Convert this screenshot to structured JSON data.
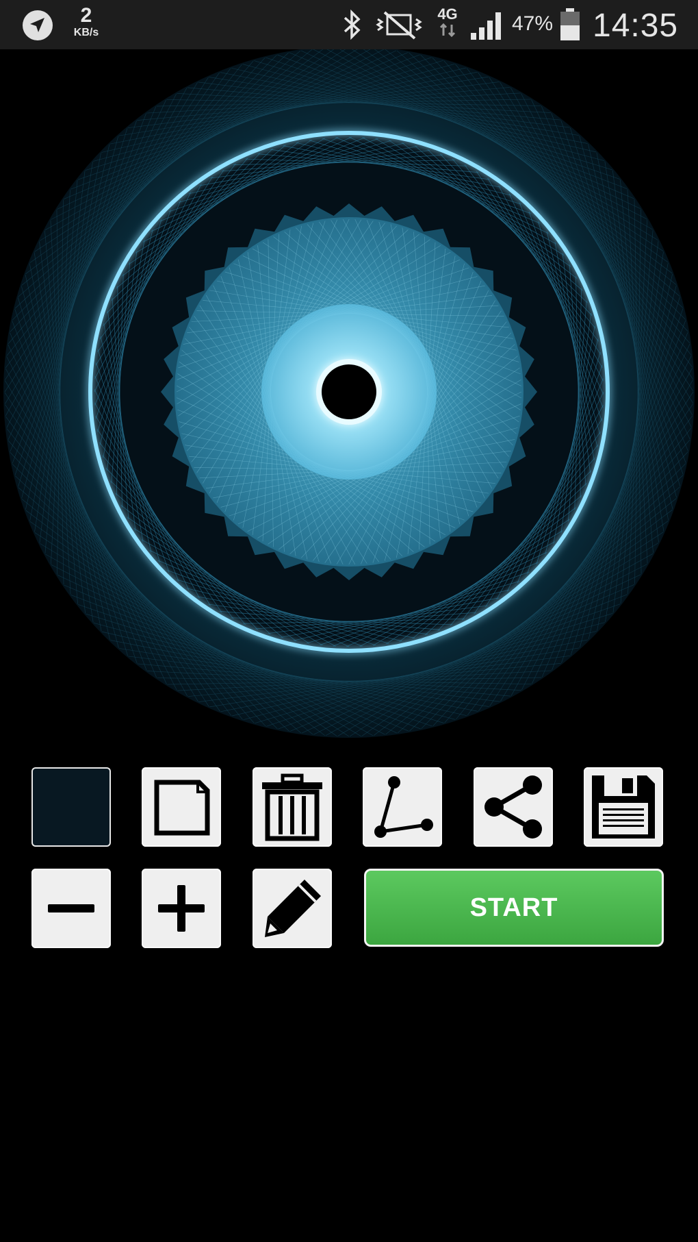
{
  "status_bar": {
    "speed_value": "2",
    "speed_unit": "KB/s",
    "network_type": "4G",
    "battery_percent": "47%",
    "time": "14:35",
    "icons": [
      "navigation-arrow-icon",
      "bluetooth-icon",
      "vibrate-mute-icon",
      "network-4g-icon",
      "signal-icon",
      "battery-icon"
    ]
  },
  "canvas": {
    "description_colors": {
      "primary": "#5ec8ee",
      "glow": "#8fe0ff",
      "background": "#000000"
    }
  },
  "toolbar": {
    "color_swatch_value": "#081822",
    "row1_icons": [
      "color-swatch",
      "new-page-icon",
      "trash-icon",
      "nodes-icon",
      "share-icon",
      "save-icon"
    ],
    "row2_icons": [
      "minus-icon",
      "plus-icon",
      "pencil-icon"
    ],
    "start_label": "START",
    "start_color": "#4cb84f"
  }
}
